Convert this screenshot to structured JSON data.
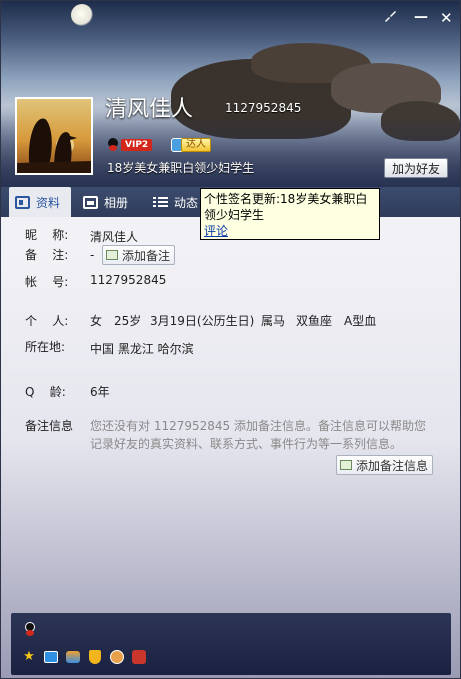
{
  "window": {
    "skin_icon": "brush-icon",
    "close_label": "✕"
  },
  "profile": {
    "nickname": "清风佳人",
    "qq_number": "1127952845",
    "vip_label": "VIP2",
    "daren_label": "达人",
    "signature": "18岁美女兼职白领少妇学生",
    "add_friend_label": "加为好友"
  },
  "tabs": [
    {
      "label": "资料",
      "icon": "id-card-icon",
      "active": true
    },
    {
      "label": "相册",
      "icon": "photo-icon",
      "active": false
    },
    {
      "label": "动态",
      "icon": "list-icon",
      "active": false
    }
  ],
  "tooltip": {
    "text": "个性签名更新:18岁美女兼职白领少妇学生",
    "link": "评论"
  },
  "info": {
    "nickname_label": "昵    称:",
    "nickname_value": "清风佳人",
    "remark_label": "备    注:",
    "remark_value": "-",
    "add_remark_button": "添加备注",
    "account_label": "帐    号:",
    "account_value": "1127952845",
    "personal_label": "个    人:",
    "gender": "女",
    "age": "25岁",
    "birthday": "3月19日(公历生日)",
    "zodiac": "属马",
    "constellation": "双鱼座",
    "blood_type": "A型血",
    "location_label": "所在地:",
    "location_value": "中国 黑龙江 哈尔滨",
    "qage_label": "Q    龄:",
    "qage_value": "6年",
    "note_label": "备注信息",
    "note_desc": "您还没有对 1127952845 添加备注信息。备注信息可以帮助您记录好友的真实资料、联系方式、事件行为等一系列信息。",
    "add_note_button": "添加备注信息"
  },
  "bottom_icons": [
    "qq-penguin-icon",
    "star-icon",
    "qzone-icon",
    "swim-icon",
    "shield-icon",
    "game-icon",
    "pet-icon"
  ],
  "colors": {
    "tab_bar": "#2f3c5a",
    "active_tab_text": "#2c56a0",
    "tooltip_bg": "#ffffe1",
    "link": "#0a3fa8",
    "vip_red": "#d4271c"
  }
}
